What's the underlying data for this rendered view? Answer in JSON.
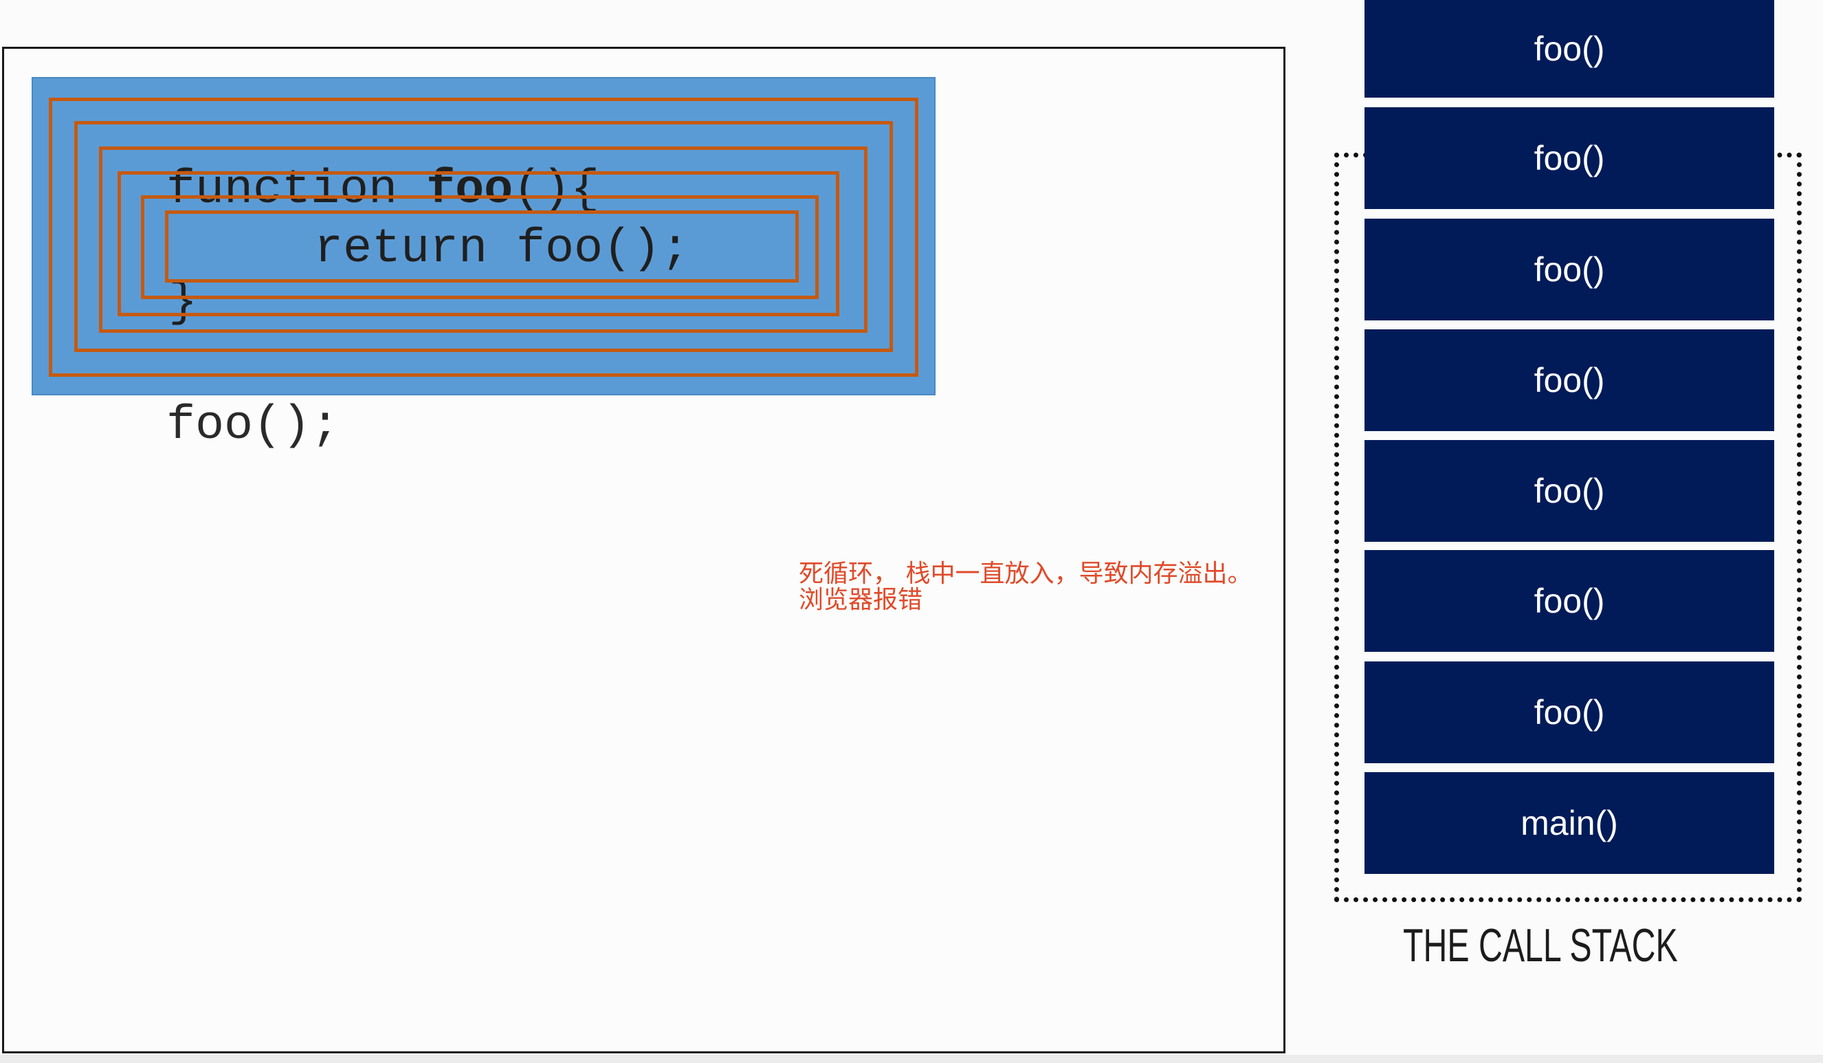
{
  "code": {
    "line1_keyword": "function",
    "line1_space": " ",
    "line1_name": "foo",
    "line1_rest": "(){",
    "line2": "return foo();",
    "line3": "}",
    "call": "foo();"
  },
  "annotation": {
    "line1": "死循环， 栈中一直放入，导致内存溢出。",
    "line2": "浏览器报错"
  },
  "call_stack": {
    "frames": [
      "foo()",
      "foo()",
      "foo()",
      "foo()",
      "foo()",
      "foo()",
      "foo()",
      "main()"
    ],
    "label": "THE CALL STACK"
  },
  "colors": {
    "code_highlight": "#5b9bd5",
    "recursion_outline": "#c55a11",
    "stack_frame": "#001b58",
    "annotation_text": "#e04a2a"
  }
}
